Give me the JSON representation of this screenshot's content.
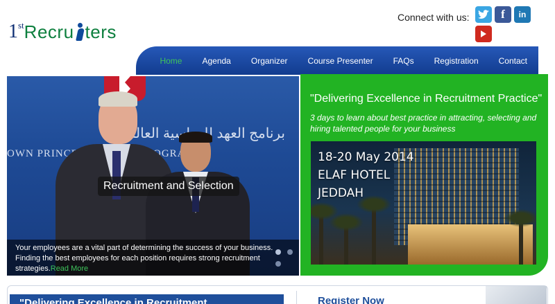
{
  "logo": {
    "prefix": "1",
    "superscript": "st",
    "word_left": "Recru",
    "word_right": "ters"
  },
  "header": {
    "connect_label": "Connect with us:"
  },
  "social": {
    "twitter": "twitter-icon",
    "facebook": "facebook-icon",
    "linkedin": "linkedin-icon",
    "youtube": "youtube-icon"
  },
  "nav": {
    "items": [
      {
        "label": "Home",
        "active": true
      },
      {
        "label": "Agenda"
      },
      {
        "label": "Organizer"
      },
      {
        "label": "Course Presenter"
      },
      {
        "label": "FAQs"
      },
      {
        "label": "Registration"
      },
      {
        "label": "Contact"
      }
    ]
  },
  "hero": {
    "caption": "Recruitment and Selection",
    "arabic_text": "برنامج العهد للدراسية العالمية",
    "program_text": "OWN PRINCE'S            SCHOLA      PROGRAM",
    "description": "Your employees are a vital part of determining the success of your business. Finding the best employees for each position requires strong recruitment strategies.",
    "read_more": "Read More"
  },
  "promo": {
    "title": "\"Delivering Excellence in Recruitment Practice\"",
    "subtitle": "3 days to learn about best practice in attracting, selecting and hiring talented people for your business",
    "date": "18-20 May 2014",
    "venue": "ELAF HOTEL",
    "city": "JEDDAH"
  },
  "bottom": {
    "left_title": "\"Delivering    Excellence    in    Recruitment",
    "right_title": "Register Now"
  },
  "colors": {
    "nav_blue": "#1a4aa3",
    "green": "#22b323",
    "active_link": "#3fc45b"
  }
}
